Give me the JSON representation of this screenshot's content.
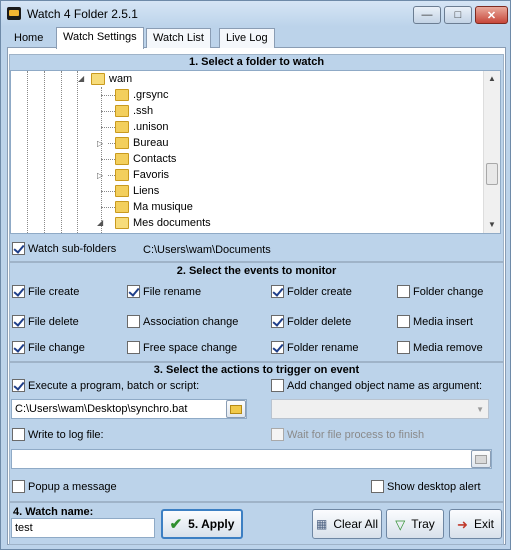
{
  "window": {
    "title": "Watch 4 Folder 2.5.1"
  },
  "tabs": [
    {
      "label": "Home"
    },
    {
      "label": "Watch Settings"
    },
    {
      "label": "Watch List"
    },
    {
      "label": "Live Log"
    }
  ],
  "section1": {
    "title": "1. Select a folder to watch",
    "tree": [
      {
        "label": "wam"
      },
      {
        "label": ".grsync"
      },
      {
        "label": ".ssh"
      },
      {
        "label": ".unison"
      },
      {
        "label": "Bureau"
      },
      {
        "label": "Contacts"
      },
      {
        "label": "Favoris"
      },
      {
        "label": "Liens"
      },
      {
        "label": "Ma musique"
      },
      {
        "label": "Mes documents"
      }
    ],
    "watch_subfolders_label": "Watch sub-folders",
    "selected_path": "C:\\Users\\wam\\Documents"
  },
  "section2": {
    "title": "2. Select the events to monitor",
    "events": [
      {
        "label": "File create",
        "checked": true
      },
      {
        "label": "File rename",
        "checked": true
      },
      {
        "label": "Folder create",
        "checked": true
      },
      {
        "label": "Folder change",
        "checked": false
      },
      {
        "label": "File delete",
        "checked": true
      },
      {
        "label": "Association change",
        "checked": false
      },
      {
        "label": "Folder delete",
        "checked": true
      },
      {
        "label": "Media insert",
        "checked": false
      },
      {
        "label": "File change",
        "checked": true
      },
      {
        "label": "Free space change",
        "checked": false
      },
      {
        "label": "Folder rename",
        "checked": true
      },
      {
        "label": "Media remove",
        "checked": false
      }
    ]
  },
  "section3": {
    "title": "3. Select the actions to trigger on event",
    "execute_label": "Execute a program, batch or script:",
    "execute_path": "C:\\Users\\wam\\Desktop\\synchro.bat",
    "add_argument_label": "Add changed object name as argument:",
    "write_log_label": "Write to log file:",
    "wait_label": "Wait for file process to finish",
    "log_path": "",
    "popup_label": "Popup a message",
    "desktop_alert_label": "Show desktop alert"
  },
  "bottom": {
    "watch_name_label": "4. Watch name:",
    "watch_name_value": "test",
    "apply_label": "5. Apply",
    "clear_label": "Clear All",
    "tray_label": "Tray",
    "exit_label": "Exit"
  },
  "colors": {
    "accent": "#3c7fc3",
    "section_bg": "#bcd3ea",
    "check": "#1f3f8a"
  }
}
